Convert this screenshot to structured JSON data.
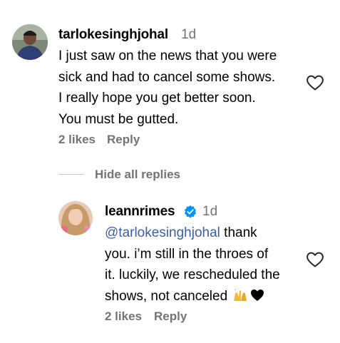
{
  "comment": {
    "username": "tarlokesinghjohal",
    "time": "1d",
    "lines": [
      "I just saw on the news that you were",
      "sick and had to cancel some shows.",
      "I really hope you get better soon.",
      "You must be gutted."
    ],
    "likes": "2 likes",
    "reply_label": "Reply",
    "like_icon": "heart-outline-icon"
  },
  "replies_toggle": {
    "label": "Hide all replies"
  },
  "reply": {
    "username": "leannrimes",
    "verified_icon": "verified-badge-icon",
    "time": "1d",
    "mention": "@tarlokesinghjohal",
    "line1_rest": " thank",
    "lines": [
      "you. i’m still in the throes of",
      "it. luckily, we rescheduled the",
      "shows, not canceled "
    ],
    "emoji": "🙌🖤",
    "likes": "2 likes",
    "reply_label": "Reply",
    "like_icon": "heart-outline-icon"
  },
  "colors": {
    "text": "#000000",
    "secondary": "#737373",
    "mention": "#3c5ea8",
    "verified": "#0095f6"
  }
}
